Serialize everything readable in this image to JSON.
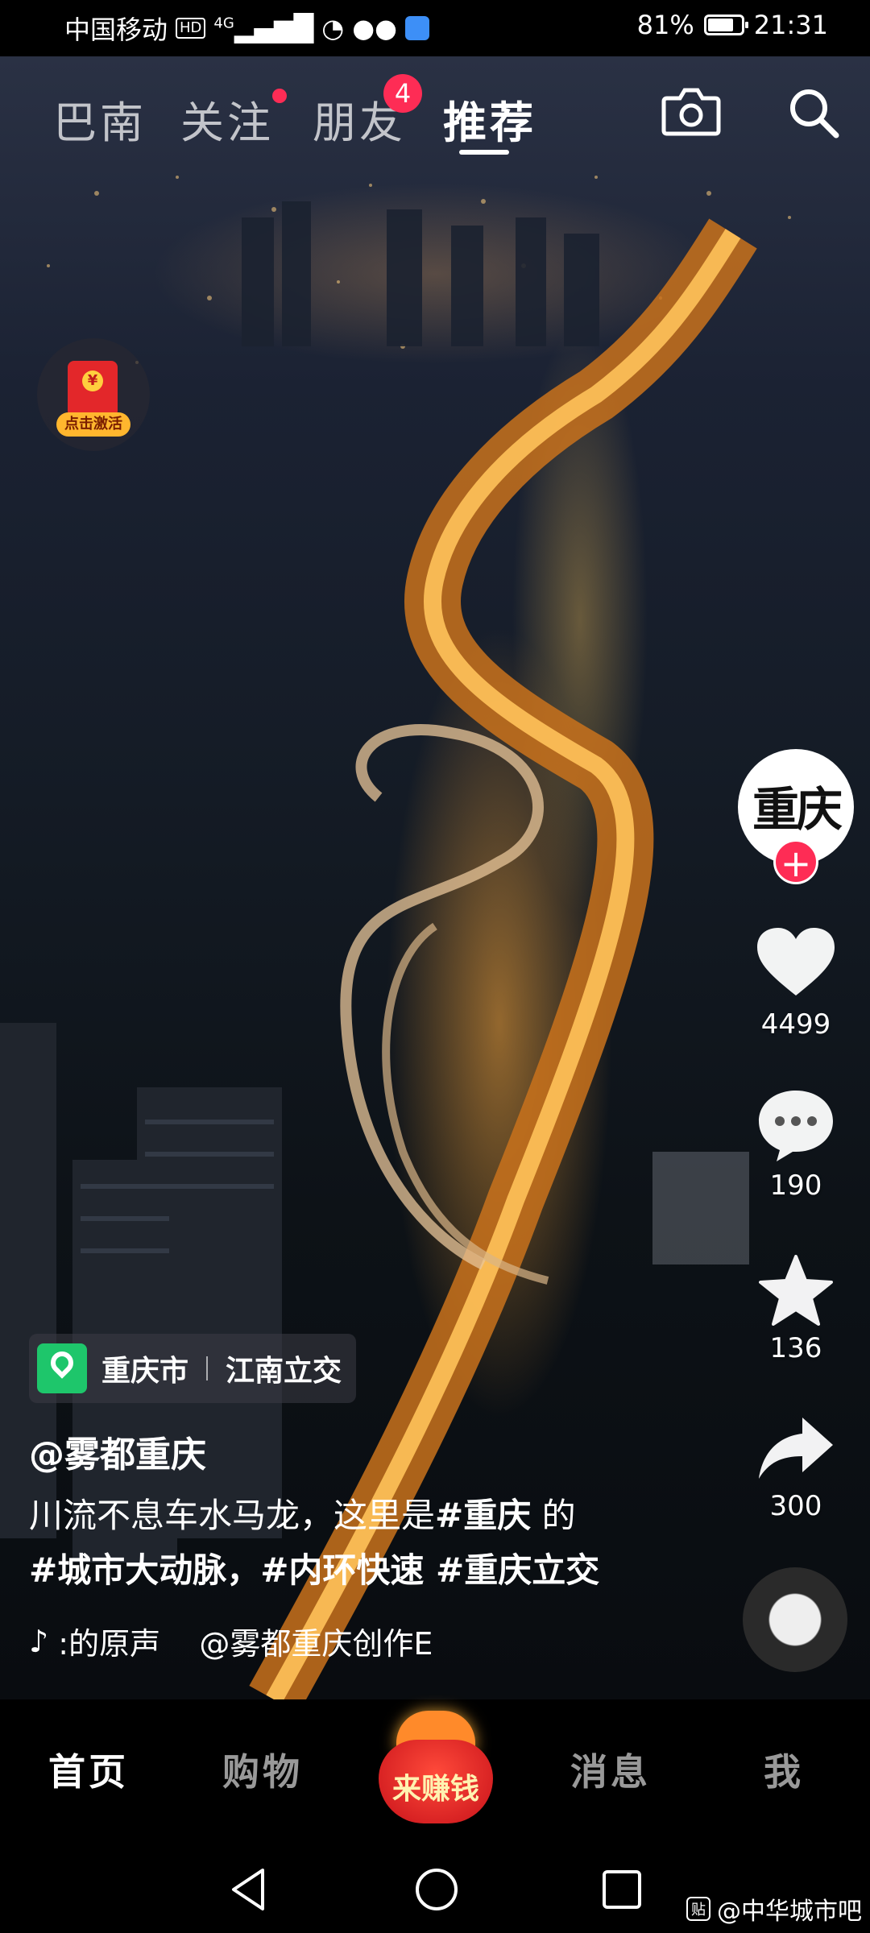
{
  "status_bar": {
    "carrier": "中国移动",
    "hd": "HD",
    "network": "4G",
    "battery_percent": "81%",
    "battery_level": 0.81,
    "time": "21:31"
  },
  "top_tabs": {
    "items": [
      {
        "label": "巴南"
      },
      {
        "label": "关注"
      },
      {
        "label": "朋友"
      },
      {
        "label": "推荐"
      }
    ],
    "active_index": 3,
    "friends_badge": "4"
  },
  "red_envelope": {
    "label": "点击激活",
    "symbol": "¥"
  },
  "creator_avatar": {
    "text": "重庆"
  },
  "actions": {
    "likes": "4499",
    "comments": "190",
    "favorites": "136",
    "shares": "300"
  },
  "location": {
    "city": "重庆市",
    "place": "江南立交"
  },
  "post": {
    "author": "@雾都重庆",
    "caption_line1_plain": "川流不息车水马龙，这里是",
    "caption_line1_tag": "#重庆",
    "caption_line1_tail": " 的",
    "caption_line2": "#城市大动脉，#内环快速 #重庆立交",
    "music": ":的原声    @雾都重庆创作E"
  },
  "bottom_nav": {
    "home": "首页",
    "shop": "购物",
    "earn": "来赚钱",
    "messages": "消息",
    "me": "我"
  },
  "watermark": "@中华城市吧",
  "colors": {
    "accent_red": "#fe2c55",
    "location_green": "#1ec66b",
    "road_light": "#ffb34a"
  }
}
